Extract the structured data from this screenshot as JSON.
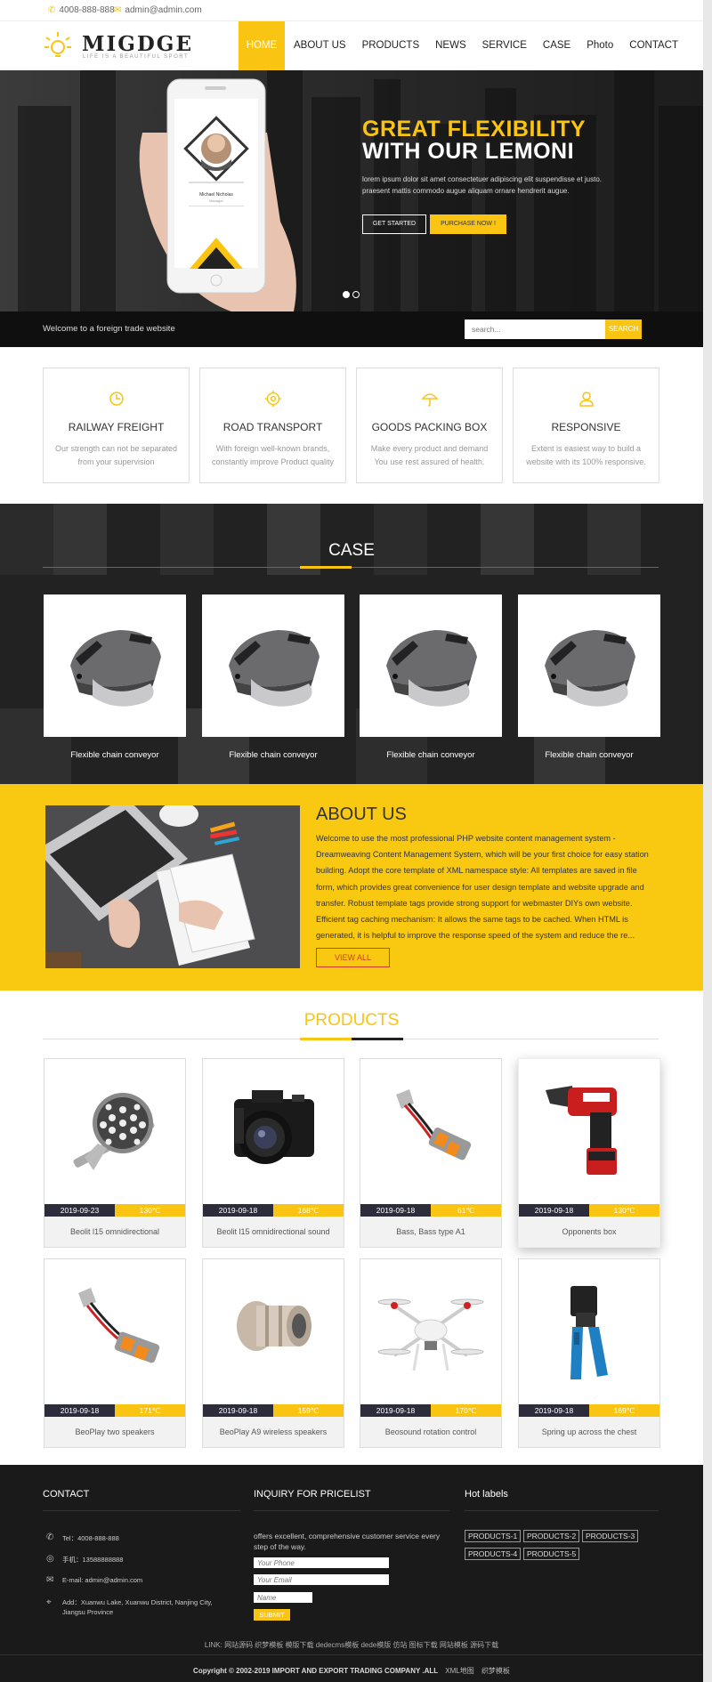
{
  "topbar": {
    "phone": "4008-888-888",
    "email": "admin@admin.com"
  },
  "logo": {
    "name": "MIGDGE",
    "slogan": "LIFE IS A BEAUTIFUL SPORT"
  },
  "nav": [
    "HOME",
    "ABOUT US",
    "PRODUCTS",
    "NEWS",
    "SERVICE",
    "CASE",
    "Photo",
    "CONTACT"
  ],
  "hero": {
    "title_line1": "GREAT FLEXIBILITY",
    "title_line2": "WITH OUR LEMONI",
    "desc": "lorem ipsum dolor sit amet consectetuer adipiscing elit suspendisse et justo. praesent mattis commodo augue aliquam ornare hendrerit augue.",
    "btn_primary": "GET STARTED",
    "btn_secondary": "PURCHASE NOW !",
    "phone_name": "Michael Nicholas",
    "phone_role": "Manager"
  },
  "welcome": {
    "text": "Welcome to a foreign trade website",
    "search_placeholder": "search...",
    "search_button": "SEARCH"
  },
  "features": [
    {
      "icon": "clock-icon",
      "title": "RAILWAY FREIGHT",
      "desc": "Our strength can not be separated from your supervision"
    },
    {
      "icon": "gear-icon",
      "title": "ROAD TRANSPORT",
      "desc": "With foreign well-known brands, constantly improve Product quality"
    },
    {
      "icon": "umbrella-icon",
      "title": "GOODS PACKING BOX",
      "desc": "Make every product and demand You use rest assured of health."
    },
    {
      "icon": "user-icon",
      "title": "RESPONSIVE",
      "desc": "Extent is easiest way to build a website with its 100% responsive."
    }
  ],
  "case": {
    "title": "CASE",
    "items": [
      "Flexible chain conveyor",
      "Flexible chain conveyor",
      "Flexible chain conveyor",
      "Flexible chain conveyor"
    ]
  },
  "about": {
    "title": "ABOUT US",
    "text": "Welcome to use the most professional PHP website content management system - Dreamweaving Content Management System, which will be your first choice for easy station building. Adopt the core template of XML namespace style: All templates are saved in file form, which provides great convenience for user design template and website upgrade and transfer. Robust template tags provide strong support for webmaster DIYs own website. Efficient tag caching mechanism: It allows the same tags to be cached. When HTML is generated, it is helpful to improve the response speed of the system and reduce the re...",
    "button": "VIEW ALL"
  },
  "products": {
    "title": "PRODUCTS",
    "items": [
      {
        "date": "2019-09-23",
        "temp": "130℃",
        "name": "Beolit l15 omnidirectional",
        "icon": "floodlight-icon"
      },
      {
        "date": "2019-09-18",
        "temp": "168℃",
        "name": "Beolit l15 omnidirectional sound",
        "icon": "camera-icon"
      },
      {
        "date": "2019-09-18",
        "temp": "61℃",
        "name": "Bass, Bass type A1",
        "icon": "wire-connector-icon"
      },
      {
        "date": "2019-09-18",
        "temp": "130℃",
        "name": "Opponents box",
        "icon": "rebar-tier-icon"
      },
      {
        "date": "2019-09-18",
        "temp": "171℃",
        "name": "BeoPlay two speakers",
        "icon": "wire-connector-icon"
      },
      {
        "date": "2019-09-18",
        "temp": "159℃",
        "name": "BeoPlay A9 wireless speakers",
        "icon": "metal-fitting-icon"
      },
      {
        "date": "2019-09-18",
        "temp": "170℃",
        "name": "Beosound rotation control",
        "icon": "drone-icon"
      },
      {
        "date": "2019-09-18",
        "temp": "169℃",
        "name": "Spring up across the chest",
        "icon": "crimp-tool-icon"
      }
    ]
  },
  "footer": {
    "contact_title": "CONTACT",
    "tel": "Tel：4008-888-888",
    "mobile": "手机：13588888888",
    "email": "E-mail: admin@admin.com",
    "address": "Add：Xuanwu Lake, Xuanwu District, Nanjing City, Jiangsu Province",
    "inquiry_title": "INQUIRY FOR PRICELIST",
    "inquiry_desc": "offers excellent, comprehensive customer service every step of the way.",
    "phone_placeholder": "Your Phone",
    "email_placeholder": "Your Email",
    "name_placeholder": "Name",
    "submit": "SUBMIT",
    "labels_title": "Hot labels",
    "tags": [
      "PRODUCTS-1",
      "PRODUCTS-2",
      "PRODUCTS-3",
      "PRODUCTS-4",
      "PRODUCTS-5"
    ],
    "links": "LINK: 网站源码 织梦模板 模版下载 dedecms模板 dede模版 仿站 图标下载 网站模板 源码下载",
    "copyright": "Copyright © 2002-2019 IMPORT AND EXPORT TRADING COMPANY .ALL",
    "xml_map": "XML地图",
    "dede_template": "织梦模板"
  },
  "colors": {
    "accent": "#f9c412",
    "dark": "#1a1a1a",
    "about_bg": "#f9c912"
  }
}
